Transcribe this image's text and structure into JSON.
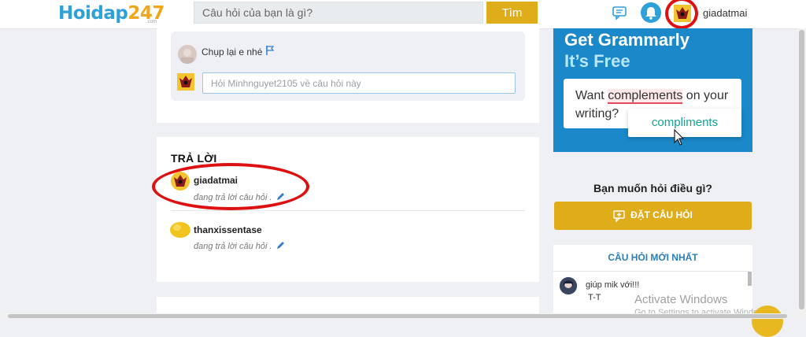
{
  "header": {
    "logo_main": "Hoidap",
    "logo_num": "247",
    "logo_sub": ".com",
    "search_placeholder": "Câu hỏi của bạn là gì?",
    "search_button": "Tìm",
    "username": "giadatmai"
  },
  "comment": {
    "author_text": "Chụp lại e nhé",
    "input_placeholder": "Hỏi Minhnguyet2105 về câu hỏi này"
  },
  "answers": {
    "title": "TRẢ LỜI",
    "items": [
      {
        "name": "giadatmai",
        "status": "đang trả lời câu hỏi ."
      },
      {
        "name": "thanxissentase",
        "status": "đang trả lời câu hỏi ."
      }
    ]
  },
  "ad": {
    "title1": "Get Grammarly",
    "title2": "It’s Free",
    "line1_pre": "Want ",
    "line1_err": "complements",
    "line1_post": " on your",
    "line2": "writing?",
    "suggestion": "compliments"
  },
  "ask": {
    "title": "Bạn muốn hỏi điều gì?",
    "button": "ĐẶT CÂU HỎI"
  },
  "latest": {
    "title": "CÂU HỎI MỚI NHẤT",
    "question": "giúp mik với!!!",
    "question_line2": "T-T"
  },
  "overlay": {
    "activate": "Activate Windows",
    "activate_sub": "Go to Settings to activate Windows."
  },
  "colors": {
    "brand_blue": "#2ea1d8",
    "brand_yellow": "#e0ad1a",
    "annotation_red": "#dd1111"
  }
}
